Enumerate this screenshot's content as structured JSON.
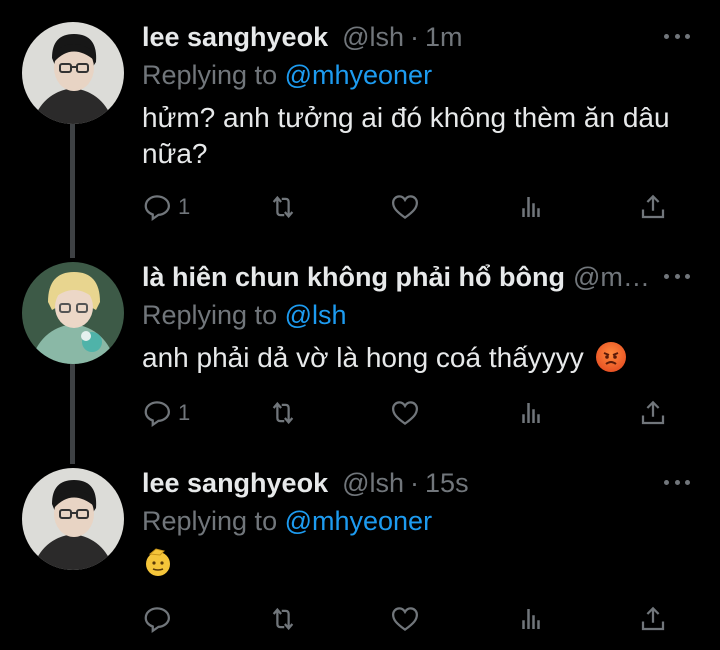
{
  "tweets": [
    {
      "name": "lee sanghyeok",
      "handle": "@lsh",
      "dot": "·",
      "time": "1m",
      "replying_prefix": "Replying to ",
      "replying_to": "@mhyeoner",
      "text": "hửm? anh tưởng ai đó không thèm ăn dâu nữa?",
      "reply_count": "1",
      "avatar": "person-avatar-glasses"
    },
    {
      "name": "là hiên chun không phải hổ bông",
      "handle": "@m…",
      "replying_prefix": "Replying to ",
      "replying_to": "@lsh",
      "text": "anh phải dả vờ là hong coá thấyyyy",
      "emoji": "angry-face-emoji",
      "reply_count": "1",
      "avatar": "person-avatar-blonde"
    },
    {
      "name": "lee sanghyeok",
      "handle": "@lsh",
      "dot": "·",
      "time": "15s",
      "replying_prefix": "Replying to ",
      "replying_to": "@mhyeoner",
      "emoji": "saluting-face-emoji",
      "reply_count": "",
      "avatar": "person-avatar-glasses"
    }
  ],
  "colors": {
    "background": "#000000",
    "text": "#e7e9ea",
    "muted": "#71767b",
    "link": "#1d9bf0",
    "thread_line": "#3e4144"
  }
}
